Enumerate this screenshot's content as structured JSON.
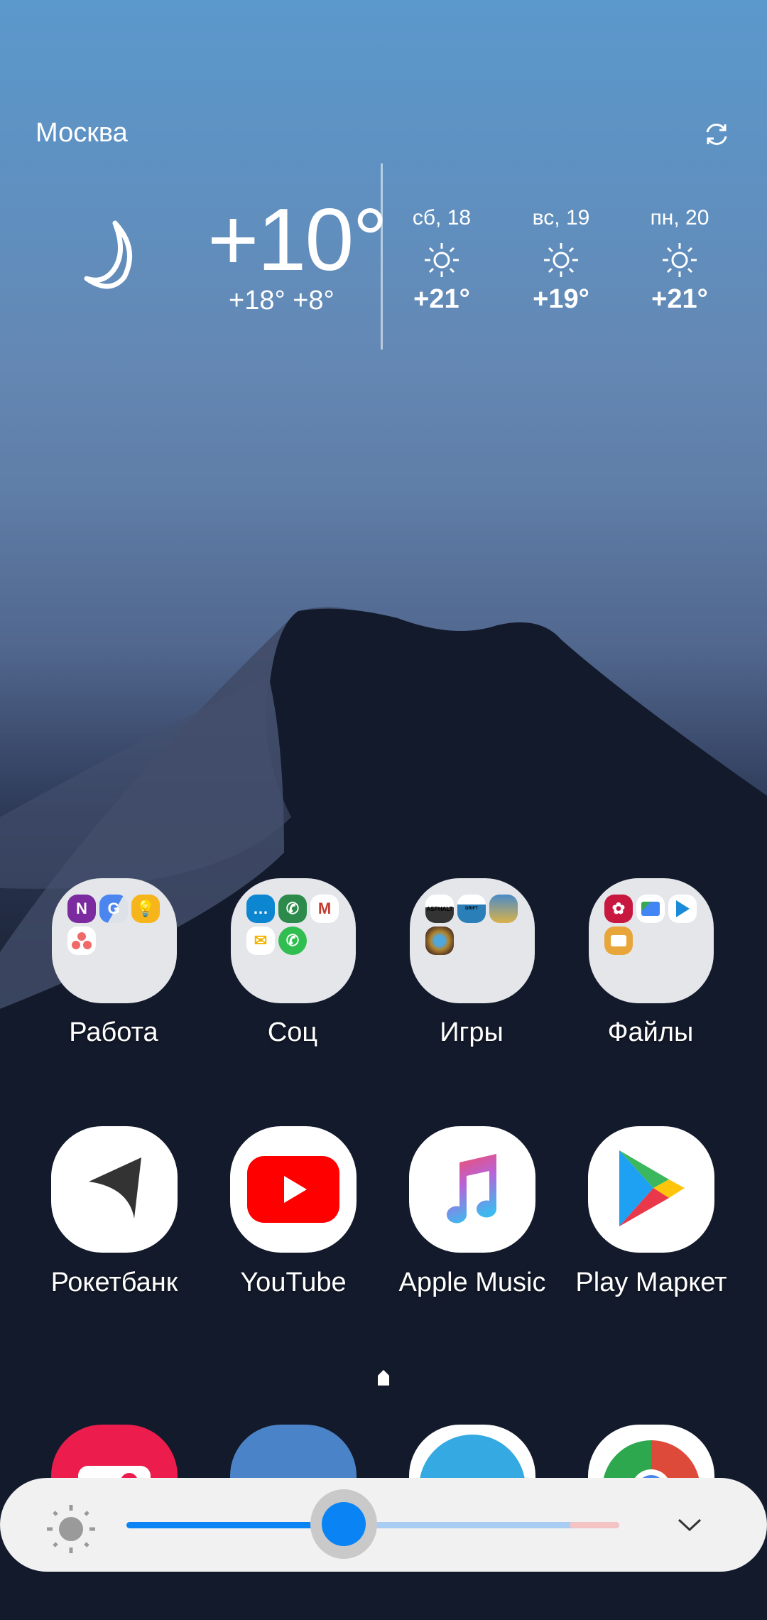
{
  "weather": {
    "city": "Москва",
    "refresh_icon": "refresh-icon",
    "current_icon": "moon-icon",
    "current_temp": "+10°",
    "high_low": "+18° +8°",
    "forecast": [
      {
        "date": "сб, 18",
        "icon": "sun-icon",
        "temp": "+21°"
      },
      {
        "date": "вс, 19",
        "icon": "sun-icon",
        "temp": "+19°"
      },
      {
        "date": "пн, 20",
        "icon": "sun-icon",
        "temp": "+21°"
      }
    ]
  },
  "folders": [
    {
      "label": "Работа",
      "apps": [
        "OneNote",
        "Google Translate",
        "Keep",
        "Asana"
      ]
    },
    {
      "label": "Соц",
      "apps": [
        "Messages",
        "Phone",
        "Gmail",
        "Яндекс.Почта",
        "WhatsApp"
      ]
    },
    {
      "label": "Игры",
      "apps": [
        "Asphalt 9",
        "Drift Racing 2",
        "PUBG Mobile",
        "Hearthstone"
      ]
    },
    {
      "label": "Файлы",
      "apps": [
        "Gallery",
        "Files by Google",
        "Play Movies",
        "My Files"
      ]
    }
  ],
  "apps": [
    {
      "label": "Рокетбанк",
      "icon": "rocketbank-icon"
    },
    {
      "label": "YouTube",
      "icon": "youtube-icon"
    },
    {
      "label": "Apple Music",
      "icon": "apple-music-icon"
    },
    {
      "label": "Play Маркет",
      "icon": "play-store-icon"
    }
  ],
  "dock": [
    {
      "icon": "camera-icon"
    },
    {
      "icon": "vk-icon"
    },
    {
      "icon": "telegram-icon"
    },
    {
      "icon": "chrome-icon"
    }
  ],
  "brightness": {
    "icon": "brightness-icon",
    "level_percent": 44,
    "expand_icon": "chevron-down-icon",
    "colors": {
      "fill": "#0a84f5",
      "track": "#a9cdf2",
      "overbright": "#f4c4c4"
    }
  },
  "page_indicator": "home-icon"
}
